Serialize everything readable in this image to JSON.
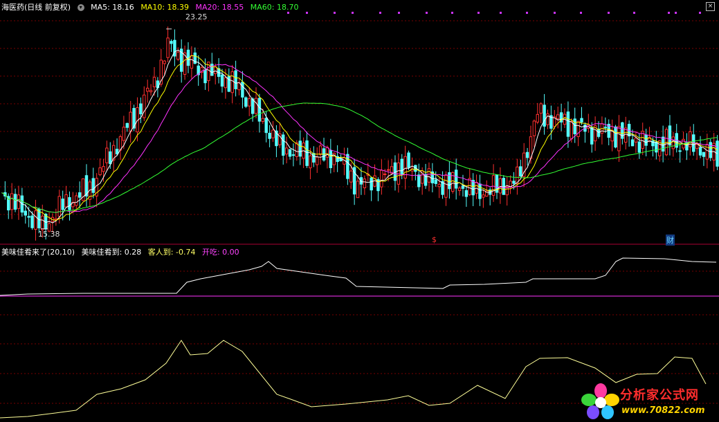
{
  "header": {
    "stock_name": "海医药(日线 前复权)",
    "ma5": "MA5: 18.16",
    "ma10": "MA10: 18.39",
    "ma20": "MA20: 18.55",
    "ma60": "MA60: 18.70"
  },
  "colors": {
    "up": "#ff3030",
    "down": "#54ffff",
    "ma5": "#ffffff",
    "ma10": "#ffff00",
    "ma20": "#ff33ff",
    "ma60": "#33ff33",
    "grid": "#7a0000",
    "axis": "#aa0033",
    "panel2_label": "#ffffff",
    "panel2_value2": "#ffff66",
    "panel2_value3": "#ff44ff",
    "text_header": "#ffffff"
  },
  "price_annotations": {
    "high": "23.25",
    "low": "15.38"
  },
  "event_markers": {
    "marker_s": "$",
    "marker_cai": "财"
  },
  "indicator_panel": {
    "label": "美味佳肴来了(20,10)",
    "value1": "美味佳肴到: 0.28",
    "value2": "客人到: -0.74",
    "value3": "开吃: 0.00"
  },
  "watermark": {
    "title": "分析家公式网",
    "url": "www.70822.com",
    "logo_icon": "flower-logo-icon"
  },
  "chart_data": {
    "type": "candlestick",
    "y_range": [
      14.8,
      23.9
    ],
    "grid": true,
    "legend": "top-left",
    "candle_count": 145,
    "key_prices": {
      "start": 16.8,
      "low": 15.38,
      "high": 23.25,
      "end": 18.1
    },
    "ma_labels": [
      "MA5",
      "MA10",
      "MA20",
      "MA60"
    ],
    "ma_values_last": [
      18.16,
      18.39,
      18.55,
      18.7
    ],
    "indicator_lines": [
      "美味佳肴到",
      "客人到",
      "开吃"
    ],
    "indicator_values_last": [
      0.28,
      -0.74,
      0.0
    ]
  }
}
